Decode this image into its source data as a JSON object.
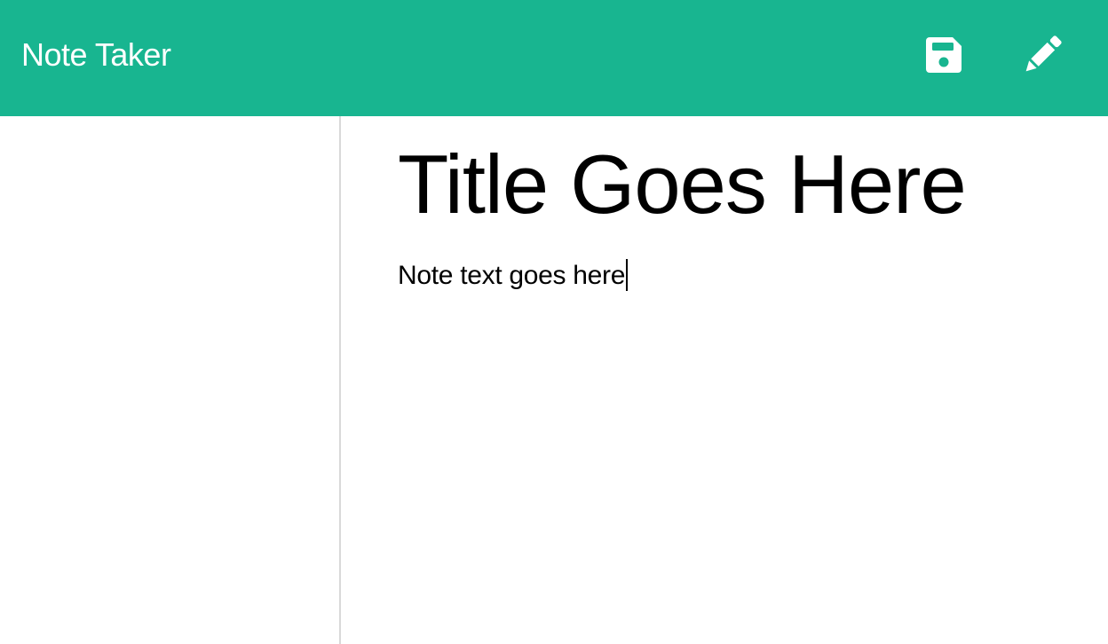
{
  "app": {
    "brand": "Note Taker",
    "accent_color": "#18b590"
  },
  "toolbar": {
    "save_icon": "floppy-disk-icon",
    "edit_icon": "pencil-icon"
  },
  "note": {
    "title": "Title Goes Here",
    "text": "Note text goes here"
  }
}
